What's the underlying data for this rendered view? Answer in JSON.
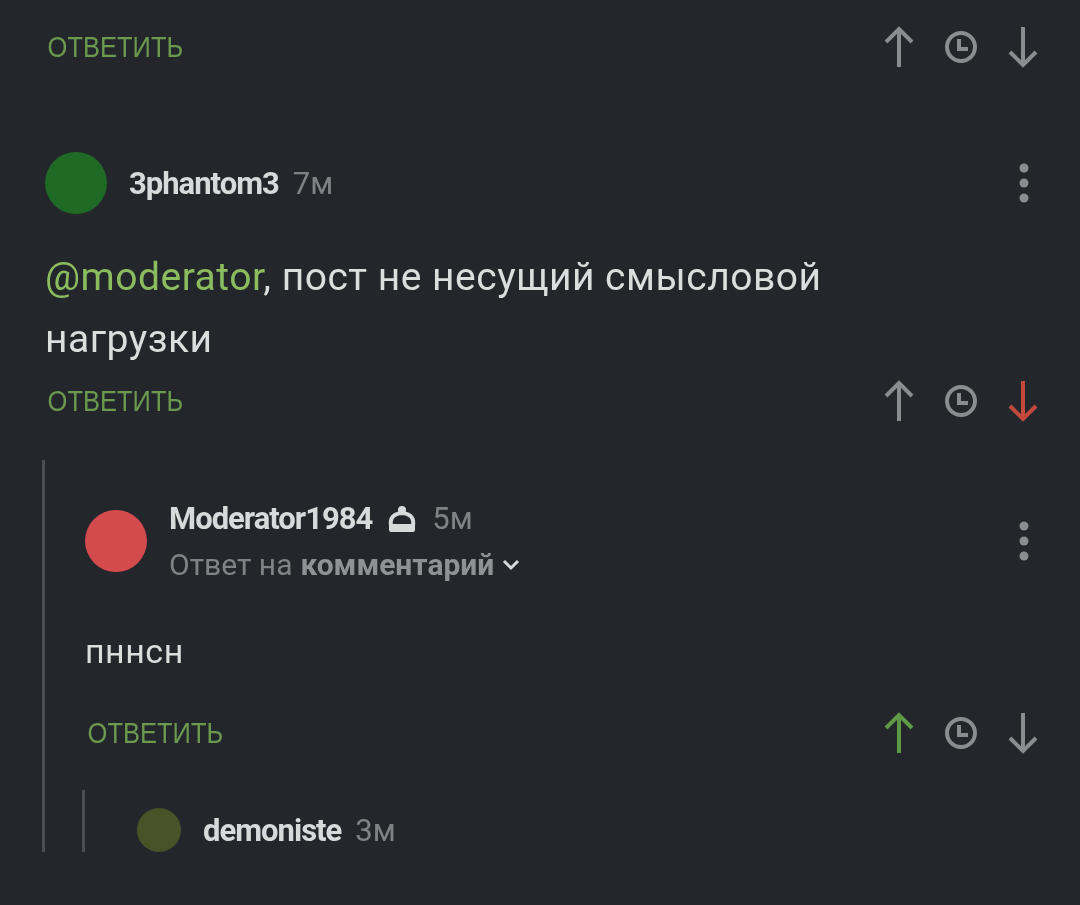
{
  "top_actions": {
    "reply": "ОТВЕТИТЬ",
    "upvoted": false,
    "downvoted": false
  },
  "comment": {
    "author": "3phantom3",
    "time": "7м",
    "mention": "@moderator",
    "text": ", пост не несущий смысловой нагрузки",
    "actions": {
      "reply": "ОТВЕТИТЬ",
      "upvoted": false,
      "downvoted": true
    },
    "replies": [
      {
        "author": "Moderator1984",
        "badge": true,
        "time": "5м",
        "reply_to_prefix": "Ответ на",
        "reply_to_link": "комментарий",
        "text": "пннсн",
        "actions": {
          "reply": "ОТВЕТИТЬ",
          "upvoted": true,
          "downvoted": false
        },
        "replies": [
          {
            "author": "demoniste",
            "time": "3м"
          }
        ]
      }
    ]
  }
}
